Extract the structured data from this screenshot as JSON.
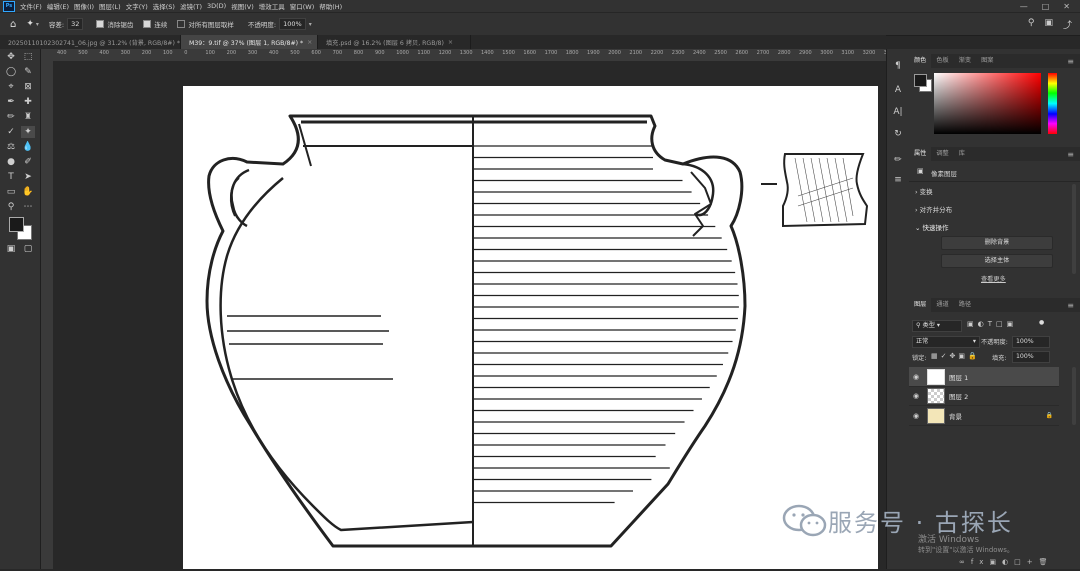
{
  "app": {
    "badge": "Ps"
  },
  "menu": [
    "文件(F)",
    "编辑(E)",
    "图像(I)",
    "图层(L)",
    "文字(Y)",
    "选择(S)",
    "滤镜(T)",
    "3D(D)",
    "视图(V)",
    "增效工具",
    "窗口(W)",
    "帮助(H)"
  ],
  "options": {
    "tolerance_label": "容差:",
    "tolerance_value": "32",
    "antialias_label": "消除锯齿",
    "contiguous_label": "连续",
    "all_layers_label": "对所有图层取样",
    "opacity_label": "不透明度:",
    "opacity_value": "100%"
  },
  "tabs": [
    {
      "label": "20250110102302741_06.jpg @ 31.2% (背景, RGB/8#) *",
      "active": false
    },
    {
      "label": "M39：9.tif @ 37% (图层 1, RGB/8#) *",
      "active": true
    },
    {
      "label": "填充.psd @ 16.2% (图层 6 拷贝, RGB/8)",
      "active": false
    }
  ],
  "ruler_ticks": [
    "400",
    "500",
    "400",
    "300",
    "200",
    "100",
    "0",
    "100",
    "200",
    "300",
    "400",
    "500",
    "600",
    "700",
    "800",
    "900",
    "1000",
    "1100",
    "1200",
    "1300",
    "1400",
    "1500",
    "1600",
    "1700",
    "1800",
    "1900",
    "2000",
    "2100",
    "2200",
    "2300",
    "2400",
    "2500",
    "2600",
    "2700",
    "2800",
    "2900",
    "3000",
    "3100",
    "3200",
    "3300"
  ],
  "color_panel": {
    "tabs": [
      "颜色",
      "色板",
      "渐变",
      "图案"
    ]
  },
  "properties_panel": {
    "tabs": [
      "属性",
      "调整",
      "库"
    ],
    "type_label": "像素图层",
    "sections": [
      "变换",
      "对齐并分布",
      "快速操作"
    ],
    "buttons": [
      "删除背景",
      "选择主体"
    ],
    "more_link": "查看更多"
  },
  "layers_panel": {
    "tabs": [
      "图层",
      "通道",
      "路径"
    ],
    "filter_label": "类型",
    "blend_mode": "正常",
    "opacity_label": "不透明度:",
    "opacity_value": "100%",
    "lock_label": "锁定:",
    "fill_label": "填充:",
    "fill_value": "100%",
    "layers": [
      {
        "name": "图层 1",
        "selected": true,
        "thumb": "drawing"
      },
      {
        "name": "图层 2",
        "selected": false,
        "thumb": "transparent"
      },
      {
        "name": "背景",
        "selected": false,
        "thumb": "yellow",
        "locked": true
      }
    ]
  },
  "watermark": {
    "text": "服务号 · 古探长"
  },
  "activation": {
    "line1": "激活 Windows",
    "line2": "转到\"设置\"以激活 Windows。"
  },
  "colors": {
    "accent": "#31a8ff",
    "panel": "#323232",
    "canvas_bg": "#282828",
    "foreground": "#1a1a1a",
    "background": "#ffffff"
  }
}
